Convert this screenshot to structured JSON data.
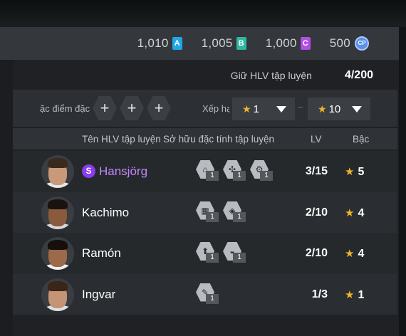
{
  "currencies": [
    {
      "value": "1,010",
      "badge": "A",
      "color": "#1fa8e8"
    },
    {
      "value": "1,005",
      "badge": "B",
      "color": "#2fb8a0"
    },
    {
      "value": "1,000",
      "badge": "C",
      "color": "#b44de6"
    },
    {
      "value": "500",
      "badge": "CP",
      "color": "#5a8fe6"
    }
  ],
  "hold": {
    "label": "Giữ HLV tập luyện",
    "count": "4/200"
  },
  "filter": {
    "trait_label": "ặc điểm đặc",
    "rank_label": "Xếp hạng",
    "min_rank": "1",
    "max_rank": "10",
    "separator": "~",
    "plus": "+"
  },
  "columns": {
    "name": "Tên HLV tập luyện",
    "traits": "Sở hữu đặc tính tập luyện",
    "lv": "LV",
    "rank": "Bậc"
  },
  "coaches": [
    {
      "name": "Hansjörg",
      "special_badge": "S",
      "traits": [
        {
          "icon": "whistle-icon",
          "count": "1"
        },
        {
          "icon": "arrows-icon",
          "count": "1"
        },
        {
          "icon": "gear-icon",
          "count": "1"
        }
      ],
      "lv": "3/15",
      "rank": "5"
    },
    {
      "name": "Kachimo",
      "traits": [
        {
          "icon": "pitch-icon",
          "count": "1"
        },
        {
          "icon": "shield-icon",
          "count": "1"
        }
      ],
      "lv": "2/10",
      "rank": "4"
    },
    {
      "name": "Ramón",
      "traits": [
        {
          "icon": "upgrade-icon",
          "count": "1"
        },
        {
          "icon": "cap-icon",
          "count": "1"
        }
      ],
      "lv": "2/10",
      "rank": "4"
    },
    {
      "name": "Ingvar",
      "traits": [
        {
          "icon": "tactic-icon",
          "count": "1"
        }
      ],
      "lv": "1/3",
      "rank": "1"
    }
  ]
}
